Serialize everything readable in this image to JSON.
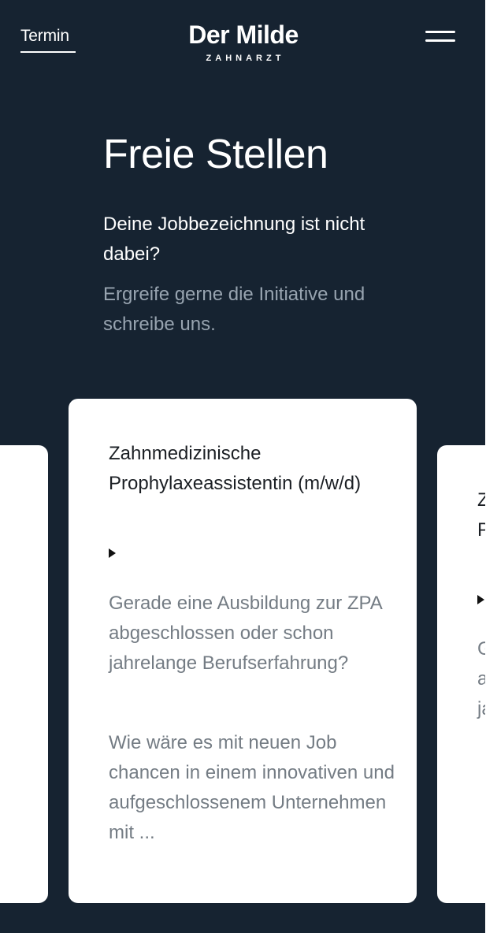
{
  "header": {
    "appointment_link": "Termin",
    "logo_name": "Der Milde",
    "logo_sub": "ZAHNARZT",
    "menu_icon": "menu-icon"
  },
  "hero": {
    "title": "Freie Stellen",
    "lead": "Deine Jobbezeichnung ist nicht dabei?",
    "subtext": "Ergreife gerne die Initiative und schreibe uns."
  },
  "jobs": {
    "current": {
      "title": "Zahnmedizinische Prophylaxeassistentin (m/w/d)",
      "expand_icon": "play-triangle-icon",
      "paragraph_1": "Gerade eine Ausbildung zur ZPA abgeschlossen oder schon jahrelange Berufserfahrung?",
      "paragraph_2": "Wie wäre es mit neuen Job chancen in einem innovativen und aufgeschlossenem Unternehmen mit ..."
    },
    "next_preview": {
      "title": "Zahnmedizinische Prophylaxeassistentin (m/w/d)",
      "paragraph_1": "Gerade eine Ausbildung zur ZPA abgeschlossen oder schon jahrelange Berufserfahrung?"
    }
  },
  "colors": {
    "background": "#162331",
    "card": "#ffffff",
    "muted_text": "#98a4b0",
    "card_text": "#747c84"
  }
}
